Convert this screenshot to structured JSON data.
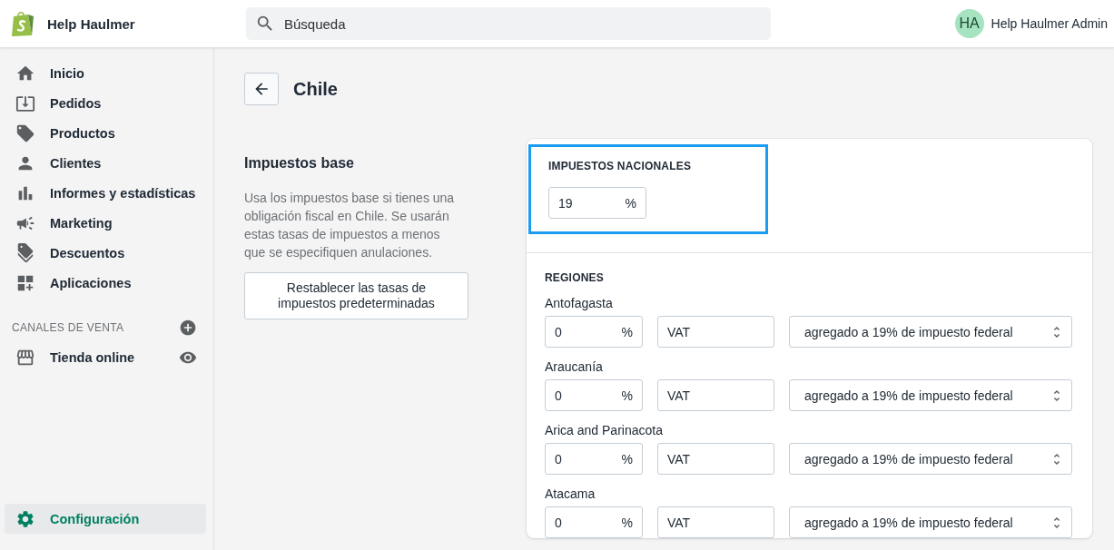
{
  "top_bar": {
    "store_name": "Help Haulmer",
    "search": {
      "placeholder": "Búsqueda"
    },
    "user": {
      "initials": "HA",
      "name": "Help Haulmer Admin"
    }
  },
  "sidebar": {
    "items": [
      {
        "label": "Inicio",
        "kind": "home",
        "selected": false
      },
      {
        "label": "Pedidos",
        "kind": "orders",
        "selected": false
      },
      {
        "label": "Productos",
        "kind": "tag",
        "selected": false
      },
      {
        "label": "Clientes",
        "kind": "person",
        "selected": false
      },
      {
        "label": "Informes y estadísticas",
        "kind": "chart",
        "selected": false
      },
      {
        "label": "Marketing",
        "kind": "megaphone",
        "selected": false
      },
      {
        "label": "Descuentos",
        "kind": "discount",
        "selected": false
      },
      {
        "label": "Aplicaciones",
        "kind": "apps",
        "selected": false
      }
    ],
    "sales_channels": {
      "title": "CANALES DE VENTA",
      "items": [
        {
          "label": "Tienda online",
          "kind": "store",
          "selected": false
        }
      ]
    },
    "settings": {
      "label": "Configuración",
      "kind": "gear",
      "selected": true
    }
  },
  "page": {
    "title": "Chile"
  },
  "base_taxes": {
    "title": "Impuestos base",
    "description": "Usa los impuestos base si tienes una obligación fiscal en Chile. Se usarán estas tasas de impuestos a menos que se especifiquen anulaciones.",
    "reset_button": "Restablecer las tasas de impuestos predeterminadas"
  },
  "national": {
    "title": "IMPUESTOS NACIONALES",
    "rate": "19",
    "unit": "%",
    "highlighted": true
  },
  "regions": {
    "title": "REGIONES",
    "rows": [
      {
        "name": "Antofagasta",
        "rate": "0",
        "unit": "%",
        "tax_name": "VAT",
        "mode": "agregado a 19% de impuesto federal"
      },
      {
        "name": "Araucanía",
        "rate": "0",
        "unit": "%",
        "tax_name": "VAT",
        "mode": "agregado a 19% de impuesto federal"
      },
      {
        "name": "Arica and Parinacota",
        "rate": "0",
        "unit": "%",
        "tax_name": "VAT",
        "mode": "agregado a 19% de impuesto federal"
      },
      {
        "name": "Atacama",
        "rate": "0",
        "unit": "%",
        "tax_name": "VAT",
        "mode": "agregado a 19% de impuesto federal"
      }
    ]
  }
}
